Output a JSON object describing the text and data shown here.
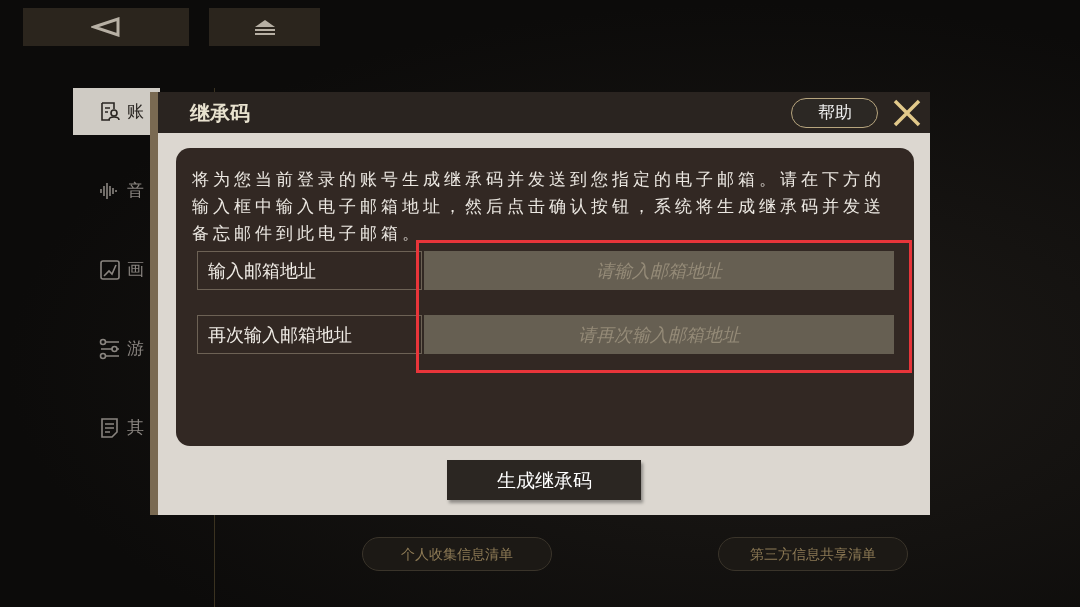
{
  "top_buttons": [
    {
      "kind": "back"
    },
    {
      "kind": "home"
    }
  ],
  "sidebar": {
    "items": [
      {
        "label": "账",
        "selected": true
      },
      {
        "label": "音",
        "selected": false
      },
      {
        "label": "画",
        "selected": false
      },
      {
        "label": "游",
        "selected": false
      },
      {
        "label": "其",
        "selected": false
      }
    ]
  },
  "footer_buttons": [
    "个人收集信息清单",
    "第三方信息共享清单"
  ],
  "dialog": {
    "title": "继承码",
    "help_button": "帮助",
    "description": "将为您当前登录的账号生成继承码并发送到您指定的电子邮箱。请在下方的输入框中输入电子邮箱地址，然后点击确认按钮，系统将生成继承码并发送备忘邮件到此电子邮箱。",
    "fields": [
      {
        "label": "输入邮箱地址",
        "placeholder": "请输入邮箱地址"
      },
      {
        "label": "再次输入邮箱地址",
        "placeholder": "请再次输入邮箱地址"
      }
    ],
    "submit_button": "生成继承码"
  }
}
